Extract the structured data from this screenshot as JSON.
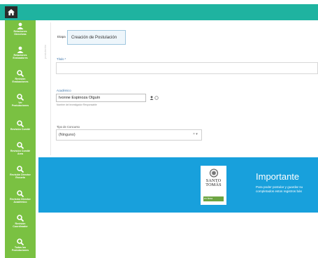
{
  "sidebar": {
    "items": [
      {
        "label": "Relaciones\nDirectivas",
        "icon": "users-icon"
      },
      {
        "label": "Relaciones\nEvaluadores",
        "icon": "users-icon"
      },
      {
        "label": "Revisión\nEvaluaciones",
        "icon": "search-icon"
      },
      {
        "label": "Ver\nPostulaciones",
        "icon": "search-icon"
      },
      {
        "label": "Revisión Comité",
        "icon": "search-icon"
      },
      {
        "label": "Revisión Comité\nArea",
        "icon": "search-icon"
      },
      {
        "label": "Revisión Director\nEscuela",
        "icon": "search-icon"
      },
      {
        "label": "Revisión Director\nAcadémico",
        "icon": "search-icon"
      },
      {
        "label": "Revisión\nCoordinador",
        "icon": "search-icon"
      },
      {
        "label": "Todas las\nPostulaciones",
        "icon": "search-icon"
      }
    ]
  },
  "form": {
    "vertical_label": "postulación",
    "etapa_label": "Etapa",
    "etapa_value": "Creación de Postulación",
    "titulo_label": "Título *",
    "titulo_value": "",
    "academico_label": "Académico",
    "academico_value": "Ivonne Espinoza Olguín",
    "academico_help": "Nombre del Investigador Responsable",
    "tipo_label": "Tipo de Concurso",
    "tipo_value": "(Ninguno)",
    "tipo_clear": "× ▾"
  },
  "banner": {
    "logo_line1": "SANTO",
    "logo_line2": "TOMÁS",
    "logo_tag": "en línea",
    "title": "Importante",
    "text_line1": "Para poder postular y guardar su",
    "text_line2": "completados estos registros bás"
  },
  "colors": {
    "topbar": "#1fb3a0",
    "sidebar": "#7ac142",
    "banner": "#18a0dc"
  }
}
